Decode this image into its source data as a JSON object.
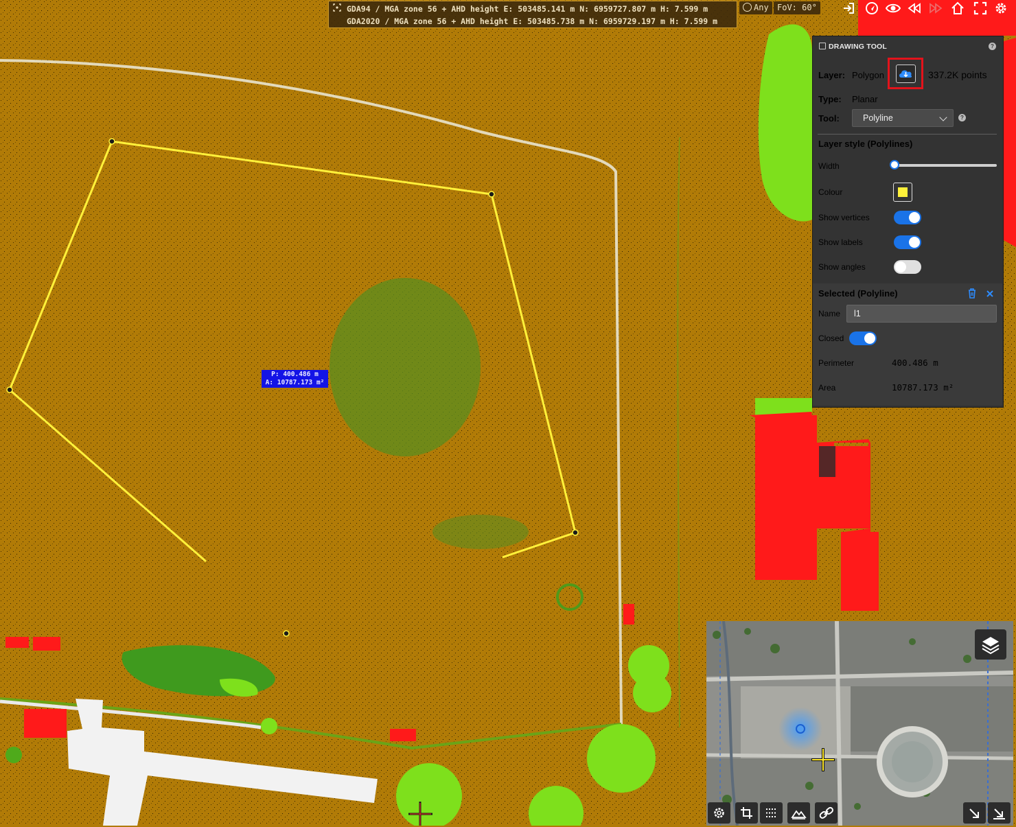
{
  "coords": {
    "line1": "GDA94 / MGA zone 56 + AHD height  E: 503485.141 m N: 6959727.807 m H: 7.599 m",
    "line2": "GDA2020 / MGA zone 56 + AHD height  E: 503485.738 m N: 6959729.197 m H: 7.599 m"
  },
  "top_pills": {
    "mode": "Any",
    "fov": "FoV: 60°"
  },
  "top_icons": [
    "login-icon",
    "navigate-icon",
    "eye-icon",
    "rewind-icon",
    "fast-forward-icon",
    "home-icon",
    "fullscreen-icon",
    "gear-icon"
  ],
  "panel": {
    "title": "DRAWING TOOL",
    "layer_label": "Layer:",
    "layer_value": "Polygon",
    "points": "337.2K points",
    "type_label": "Type:",
    "type_value": "Planar",
    "tool_label": "Tool:",
    "tool_value": "Polyline",
    "style_title": "Layer style (Polylines)",
    "width_label": "Width",
    "width_level": 0,
    "colour_label": "Colour",
    "colour_value": "#fff13a",
    "show_vertices": "Show vertices",
    "show_labels": "Show labels",
    "show_angles": "Show angles",
    "toggles": {
      "vertices": true,
      "labels": true,
      "angles": false,
      "closed": true
    },
    "selected_title": "Selected (Polyline)",
    "name_label": "Name",
    "name_value": "l1",
    "closed_label": "Closed",
    "perimeter_label": "Perimeter",
    "perimeter_value": "400.486 m",
    "area_label": "Area",
    "area_value": "10787.173 m²"
  },
  "map_label": {
    "perimeter": "P: 400.486 m",
    "area": "A: 10787.173 m²"
  },
  "colors": {
    "accent": "#1a73e8",
    "highlight": "#e3131b",
    "polyline": "#fff13a",
    "ground": "#b17b07",
    "vegetation": "#7ee01c",
    "building": "#ff1a1a"
  }
}
